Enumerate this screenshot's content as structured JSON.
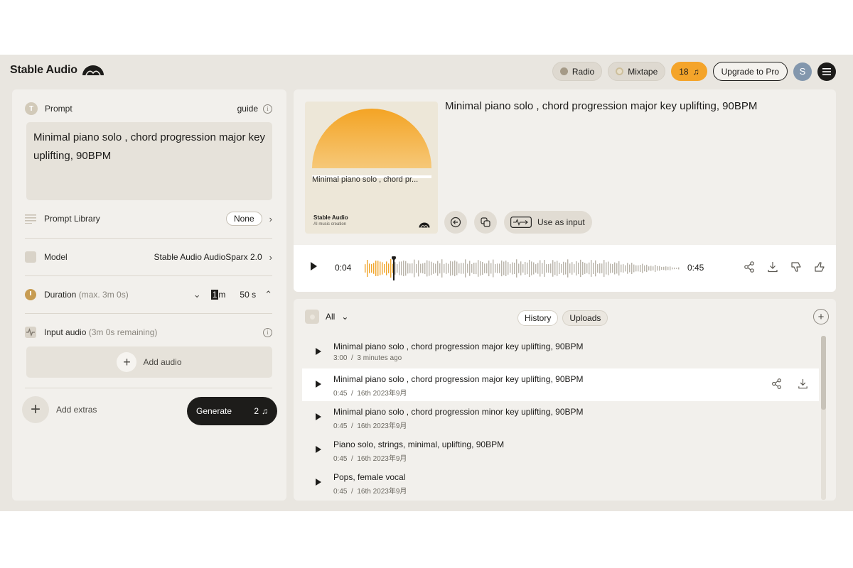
{
  "header": {
    "brand": "Stable Audio",
    "radio_label": "Radio",
    "mixtape_label": "Mixtape",
    "credits": "18",
    "upgrade_label": "Upgrade to Pro",
    "avatar_initial": "S"
  },
  "left": {
    "prompt_label": "Prompt",
    "prompt_avatar": "T",
    "guide_label": "guide",
    "prompt_text": "Minimal piano solo , chord progression major key uplifting, 90BPM",
    "prompt_library_label": "Prompt Library",
    "prompt_library_value": "None",
    "model_label": "Model",
    "model_value": "Stable Audio AudioSparx 2.0",
    "duration_label": "Duration",
    "duration_max": "(max. 3m 0s)",
    "duration_minutes": "1",
    "duration_minutes_unit": "m",
    "duration_seconds": "50",
    "duration_seconds_unit": "s",
    "input_audio_label": "Input audio",
    "input_audio_remaining": "(3m 0s remaining)",
    "add_audio_label": "Add audio",
    "add_extras_label": "Add extras",
    "generate_label": "Generate",
    "generate_cost": "2"
  },
  "player": {
    "title": "Minimal piano solo , chord progression major key uplifting, 90BPM",
    "cover_caption": "Minimal piano solo , chord pr...",
    "cover_brand": "Stable Audio",
    "cover_subtitle": "AI music creation",
    "use_as_input_label": "Use as input",
    "current_time": "0:04",
    "total_time": "0:45",
    "progress": 0.09
  },
  "library": {
    "filter_label": "All",
    "tabs": [
      "History",
      "Uploads"
    ],
    "items": [
      {
        "title": "Minimal piano solo , chord progression major key uplifting, 90BPM",
        "duration": "3:00",
        "sep": "/",
        "date": "3 minutes ago"
      },
      {
        "title": "Minimal piano solo , chord progression major key uplifting, 90BPM",
        "duration": "0:45",
        "sep": "/",
        "date": "16th 2023年9月"
      },
      {
        "title": "Minimal piano solo , chord progression minor key uplifting, 90BPM",
        "duration": "0:45",
        "sep": "/",
        "date": "16th 2023年9月"
      },
      {
        "title": "Piano solo, strings, minimal, uplifting, 90BPM",
        "duration": "0:45",
        "sep": "/",
        "date": "16th 2023年9月"
      },
      {
        "title": "Pops, female vocal",
        "duration": "0:45",
        "sep": "/",
        "date": "16th 2023年9月"
      }
    ]
  },
  "colors": {
    "accent": "#f4a42a",
    "background": "#e9e6e0",
    "panel": "#f2f0ec",
    "dark": "#1d1c1a"
  }
}
